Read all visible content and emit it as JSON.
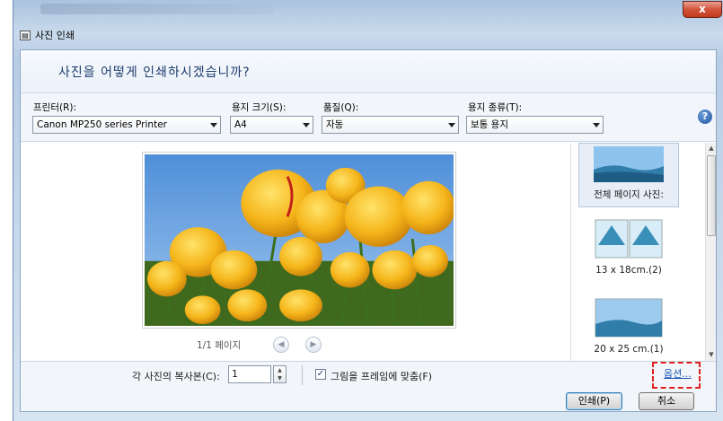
{
  "window": {
    "title": "사진 인쇄",
    "close_label": "x"
  },
  "question": "사진을 어떻게 인쇄하시겠습니까?",
  "printer": {
    "label": "프린터(R):",
    "value": "Canon MP250 series Printer"
  },
  "paper_size": {
    "label": "용지 크기(S):",
    "value": "A4"
  },
  "quality": {
    "label": "품질(Q):",
    "value": "자동"
  },
  "paper_type": {
    "label": "용지 종류(T):",
    "value": "보통 용지"
  },
  "help_icon_text": "?",
  "pager": {
    "text": "1/1 페이지",
    "prev": "◀",
    "next": "▶"
  },
  "layouts": [
    {
      "name": "전체 페이지 사진:",
      "selected": true
    },
    {
      "name": "13 x 18cm.(2)",
      "selected": false
    },
    {
      "name": "20 x 25 cm.(1)",
      "selected": false
    }
  ],
  "copies": {
    "label": "각 사진의 복사본(C):",
    "value": "1"
  },
  "fit_frame": {
    "label": "그림을 프레임에 맞춤(F)",
    "checked": true,
    "check_glyph": "✓"
  },
  "options_link": "옵션...",
  "buttons": {
    "print": "인쇄(P)",
    "cancel": "취소"
  },
  "colors": {
    "accent": "#1f3c6b",
    "highlight": "#e02020",
    "link": "#1a55b5"
  }
}
